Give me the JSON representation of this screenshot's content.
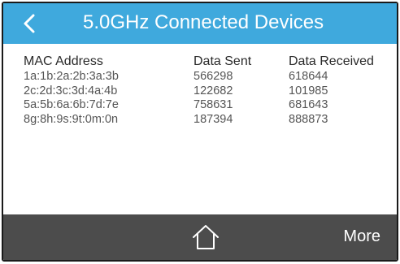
{
  "header": {
    "title": "5.0GHz Connected Devices",
    "back_icon": "chevron-left-icon"
  },
  "table": {
    "columns": [
      "MAC Address",
      "Data Sent",
      "Data Received"
    ],
    "rows": [
      [
        "1a:1b:2a:2b:3a:3b",
        "566298",
        "618644"
      ],
      [
        "2c:2d:3c:3d:4a:4b",
        "122682",
        "101985"
      ],
      [
        "5a:5b:6a:6b:7d:7e",
        "758631",
        "681643"
      ],
      [
        "8g:8h:9s:9t:0m:0n",
        "187394",
        "888873"
      ]
    ]
  },
  "footer": {
    "home_icon": "home-icon",
    "more_label": "More"
  },
  "colors": {
    "header_bg": "#3fa9dd",
    "footer_bg": "#4c4c4c",
    "text": "#555555"
  }
}
